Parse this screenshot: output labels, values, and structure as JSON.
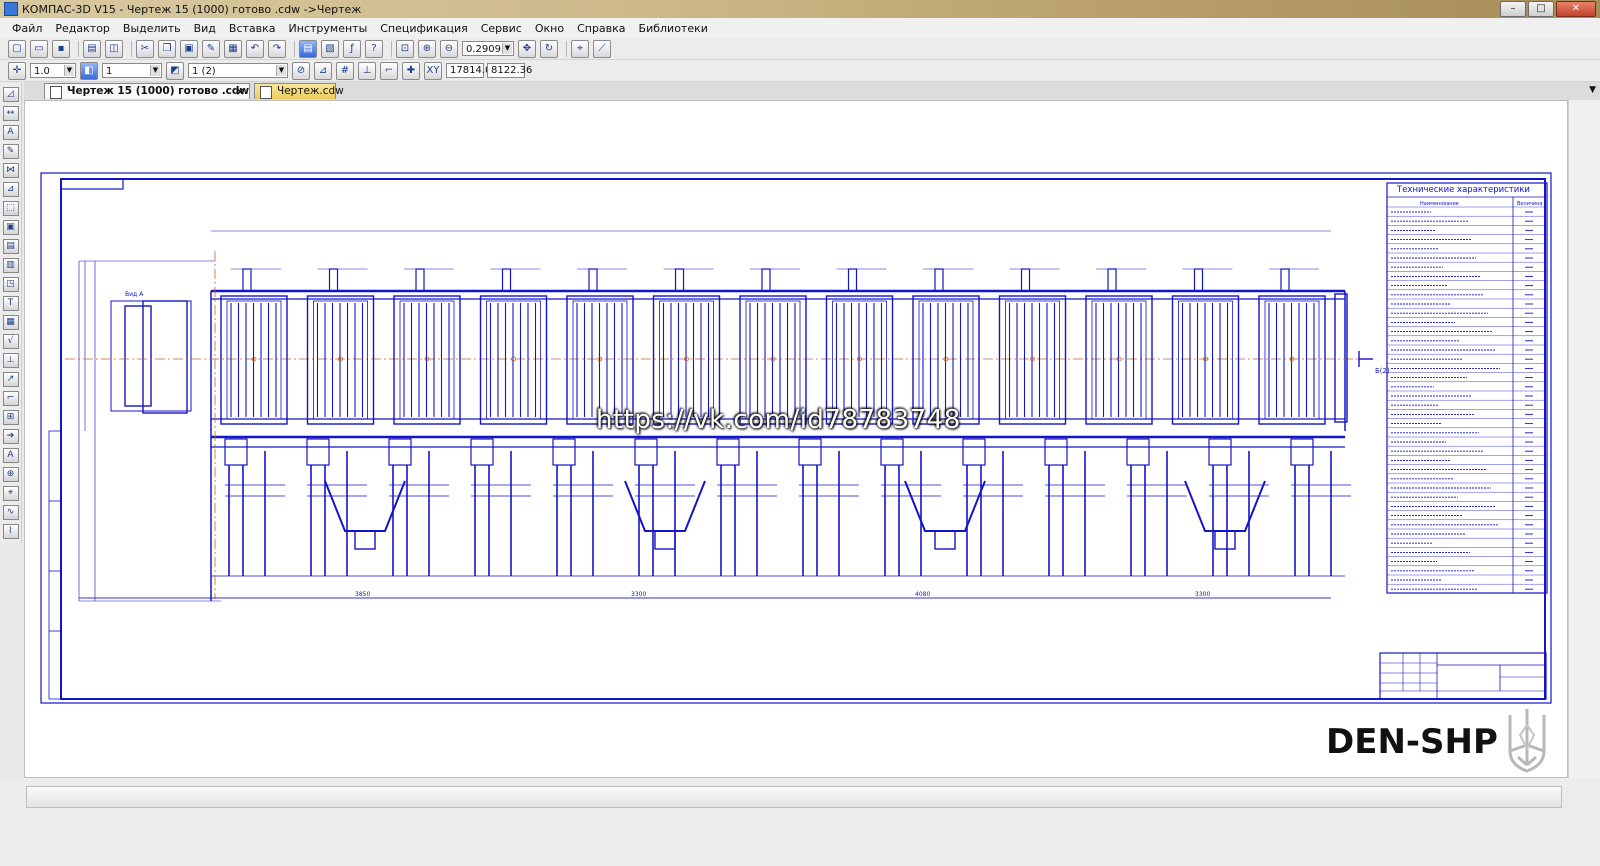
{
  "window": {
    "title": "КОМПАС-3D V15 - Чертеж 15 (1000) готово .cdw ->Чертеж",
    "minimize": "–",
    "maximize": "□",
    "close": "✕"
  },
  "menu": {
    "items": [
      "Файл",
      "Редактор",
      "Выделить",
      "Вид",
      "Вставка",
      "Инструменты",
      "Спецификация",
      "Сервис",
      "Окно",
      "Справка",
      "Библиотеки"
    ]
  },
  "toolbar": {
    "zoom_value": "0.2909",
    "step_value": "1.0",
    "layer_value": "1",
    "view_value": "1 (2)",
    "coord_x": "17814.0",
    "coord_y": "8122.36"
  },
  "tabs": {
    "active_label": "Чертеж 15 (1000) готово .cdw",
    "active_close": "×",
    "inactive_label": "Чертеж.cdw"
  },
  "drawing": {
    "view_label": "Вид A",
    "section_mark": "Б(2)",
    "bottom_dims": [
      "3850",
      "3300",
      "4080",
      "3300"
    ]
  },
  "spec_table": {
    "title": "Технические характеристики",
    "header_left": "Наименование",
    "header_right": "Величина"
  },
  "watermarks": {
    "url": "https://vk.com/id78783748",
    "brand": "DEN-SHP"
  },
  "colors": {
    "drawing_line": "#1414c8",
    "axis_line": "#c86428",
    "titlebar": "#cdb98a"
  }
}
